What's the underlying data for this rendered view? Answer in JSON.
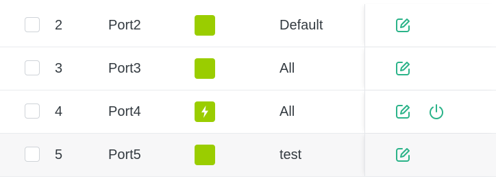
{
  "colors": {
    "status_green": "#9acd00",
    "action_teal": "#2bb389"
  },
  "rows": [
    {
      "index": "2",
      "name": "Port2",
      "status_icon": "none",
      "profile": "Default",
      "actions": [
        "edit-icon"
      ]
    },
    {
      "index": "3",
      "name": "Port3",
      "status_icon": "none",
      "profile": "All",
      "actions": [
        "edit-icon"
      ]
    },
    {
      "index": "4",
      "name": "Port4",
      "status_icon": "lightning-icon",
      "profile": "All",
      "actions": [
        "edit-icon",
        "power-icon"
      ]
    },
    {
      "index": "5",
      "name": "Port5",
      "status_icon": "none",
      "profile": "test",
      "actions": [
        "edit-icon"
      ]
    }
  ]
}
